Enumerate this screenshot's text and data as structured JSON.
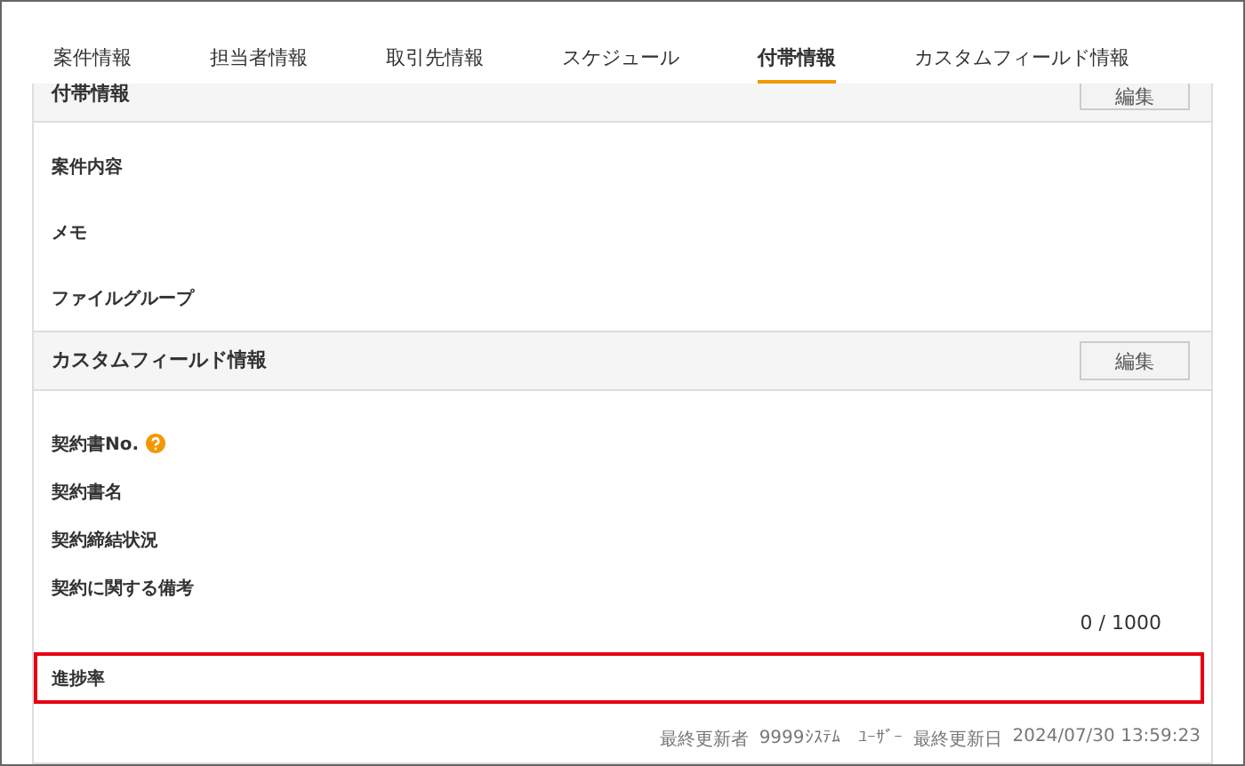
{
  "tabs": [
    {
      "label": "案件情報",
      "selected": false
    },
    {
      "label": "担当者情報",
      "selected": false
    },
    {
      "label": "取引先情報",
      "selected": false
    },
    {
      "label": "スケジュール",
      "selected": false
    },
    {
      "label": "付帯情報",
      "selected": true
    },
    {
      "label": "カスタムフィールド情報",
      "selected": false
    }
  ],
  "sections": [
    {
      "title": "付帯情報",
      "edit_button": "編集",
      "kind": "cut",
      "fields": [
        {
          "label": "案件内容",
          "help": false,
          "highlighted": false
        },
        {
          "label": "メモ",
          "help": false,
          "highlighted": false
        },
        {
          "label": "ファイルグループ",
          "help": false,
          "highlighted": false
        }
      ]
    },
    {
      "title": "カスタムフィールド情報",
      "edit_button": "編集",
      "kind": "full",
      "fields": [
        {
          "label": "契約書No.",
          "help": true,
          "highlighted": false
        },
        {
          "label": "契約書名",
          "help": false,
          "highlighted": false
        },
        {
          "label": "契約締結状況",
          "help": false,
          "highlighted": false
        },
        {
          "label": "契約に関する備考",
          "help": false,
          "highlighted": false,
          "counter": "0 / 1000"
        },
        {
          "label": "進捗率",
          "help": false,
          "highlighted": true
        }
      ]
    }
  ],
  "footer": {
    "updated_by_label": "最終更新者",
    "updated_by": "9999ｼｽﾃﾑ　ﾕｰｻﾞｰ",
    "updated_at_label": "最終更新日",
    "updated_at": "2024/07/30 13:59:23"
  }
}
